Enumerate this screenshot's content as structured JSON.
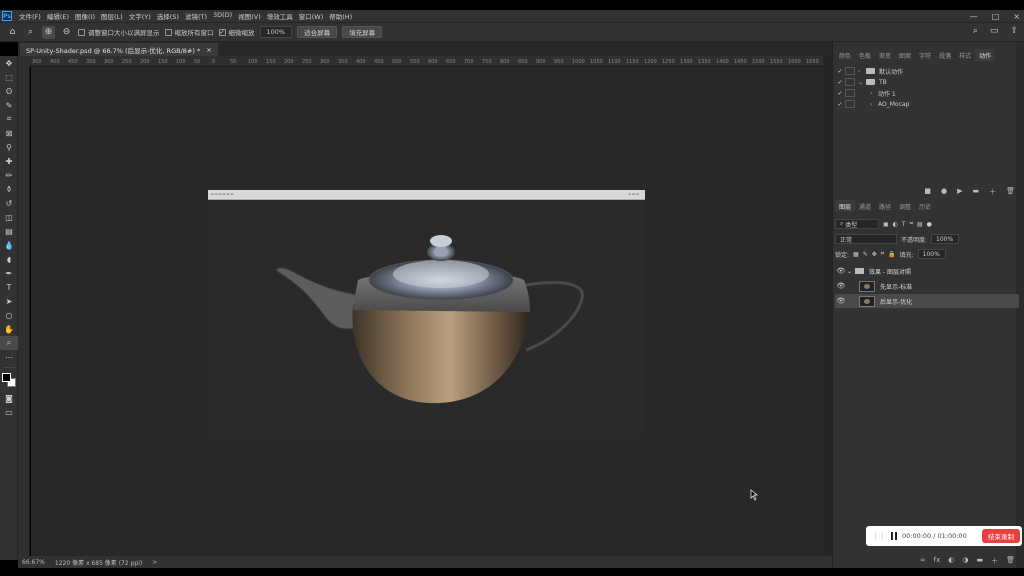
{
  "app": {
    "logo": "Ps",
    "menus": [
      "文件(F)",
      "编辑(E)",
      "图像(I)",
      "图层(L)",
      "文字(Y)",
      "选择(S)",
      "滤镜(T)",
      "3D(D)",
      "视图(V)",
      "增效工具",
      "窗口(W)",
      "帮助(H)"
    ],
    "window_controls": [
      "—",
      "□",
      "×"
    ]
  },
  "options_bar": {
    "resize_windows_label": "调整窗口大小以满屏显示",
    "zoom_all_windows_label": "缩放所有窗口",
    "scrubby_zoom_label": "细微缩放",
    "zoom_value": "100%",
    "fit_screen_label": "适合屏幕",
    "fill_screen_label": "填充屏幕"
  },
  "document": {
    "tab_title": "SP-Unity-Shader.psd @ 66.7% (后显示-优化, RGB/8#) *",
    "tab_close": "×"
  },
  "ruler": {
    "h_ticks": [
      "300",
      "400",
      "450",
      "350",
      "300",
      "250",
      "200",
      "150",
      "100",
      "50",
      "0",
      "50",
      "100",
      "150",
      "200",
      "250",
      "300",
      "350",
      "400",
      "450",
      "500",
      "550",
      "600",
      "650",
      "700",
      "750",
      "800",
      "850",
      "900",
      "950",
      "1000",
      "1050",
      "1100",
      "1150",
      "1200",
      "1250",
      "1300",
      "1350",
      "1400",
      "1450",
      "1500",
      "1550",
      "1600",
      "1650",
      "17"
    ]
  },
  "status_bar": {
    "zoom": "66.67%",
    "doc_info": "1220 像素 x 685 像素 (72 ppi)",
    "arrow": ">"
  },
  "panels": {
    "actions_tabs": [
      "颜色",
      "色板",
      "渐变",
      "图案",
      "字符",
      "段落",
      "样式",
      "动作"
    ],
    "actions_active": "动作",
    "actions": [
      {
        "label": "默认动作",
        "indent": 0,
        "expanded": false,
        "folder": true
      },
      {
        "label": "TB",
        "indent": 0,
        "expanded": true,
        "folder": true
      },
      {
        "label": "动作 1",
        "indent": 1,
        "expanded": false,
        "folder": false
      },
      {
        "label": "AO_Mocap",
        "indent": 1,
        "expanded": false,
        "folder": false
      }
    ],
    "actions_footer_icons": [
      "■",
      "●",
      "▶",
      "▬",
      "＋",
      "🗑"
    ],
    "layers_tabs": [
      "图层",
      "通道",
      "路径",
      "调整",
      "历史"
    ],
    "layers_active": "图层",
    "filter_kind": "类型",
    "blend_mode": "正常",
    "opacity_label": "不透明度:",
    "opacity_value": "100%",
    "lock_label": "锁定:",
    "fill_label": "填充:",
    "fill_value": "100%",
    "layers": [
      {
        "name": "效果 - 图层对照",
        "group": true,
        "selected": false
      },
      {
        "name": "先显示-标准",
        "group": false,
        "selected": false
      },
      {
        "name": "后显示-优化",
        "group": false,
        "selected": true
      }
    ],
    "layers_footer_icons": [
      "∞",
      "fx",
      "◐",
      "◑",
      "▬",
      "＋",
      "🗑"
    ]
  },
  "recorder": {
    "time": "00:00:00 / 01:00:00",
    "stop_label": "结束录制"
  },
  "colors": {
    "accent_red": "#e84040",
    "ps_blue": "#31a8ff"
  }
}
